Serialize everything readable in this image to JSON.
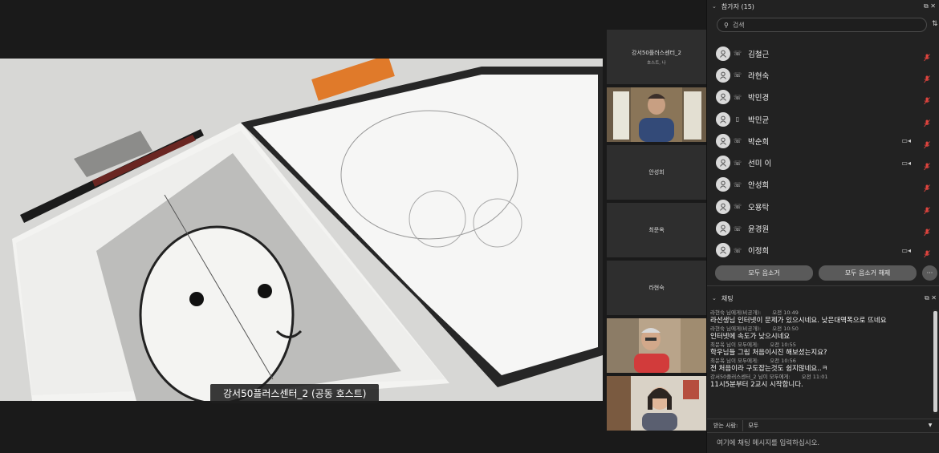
{
  "main": {
    "speaker_label": "강서50플러스센터_2 (공동 호스트)"
  },
  "thumbnails": [
    {
      "name": "강서50플러스센터_2",
      "sub": "호스트, 나",
      "video": false
    },
    {
      "name": "",
      "sub": "",
      "video": true
    },
    {
      "name": "안성희",
      "sub": "",
      "video": false
    },
    {
      "name": "최문옥",
      "sub": "",
      "video": false
    },
    {
      "name": "라현숙",
      "sub": "",
      "video": false
    },
    {
      "name": "",
      "sub": "",
      "video": true
    },
    {
      "name": "",
      "sub": "",
      "video": true
    }
  ],
  "participants": {
    "title": "참가자 (15)",
    "search_placeholder": "검색",
    "list": [
      {
        "name": "김철근",
        "device": "phone",
        "camera": false
      },
      {
        "name": "라현숙",
        "device": "phone",
        "camera": false
      },
      {
        "name": "박민경",
        "device": "phone",
        "camera": false
      },
      {
        "name": "박민균",
        "device": "mobile",
        "camera": false
      },
      {
        "name": "박순희",
        "device": "phone",
        "camera": true
      },
      {
        "name": "선미 이",
        "device": "phone",
        "camera": true
      },
      {
        "name": "안성희",
        "device": "phone",
        "camera": false
      },
      {
        "name": "오용탁",
        "device": "phone",
        "camera": false
      },
      {
        "name": "윤경원",
        "device": "phone",
        "camera": false
      },
      {
        "name": "이정희",
        "device": "phone",
        "camera": true
      }
    ],
    "mute_all": "모두 음소거",
    "unmute_all": "모두 음소거 해제",
    "more": "···"
  },
  "chat": {
    "title": "채팅",
    "messages": [
      {
        "from": "라현숙 님에게(비공개):",
        "time": "오전 10:49",
        "text": "라선생님 인터넷이 문제가 있으시네요. 낮은대역폭으로 뜨네요"
      },
      {
        "from": "라현숙 님에게(비공개):",
        "time": "오전 10:50",
        "text": "인터넷에   속도가 낮으시네요"
      },
      {
        "from": "최문옥 님이 모두에게:",
        "time": "오전 10:55",
        "text": "학우님들 그림 처음이시진 해보셨는지요?"
      },
      {
        "from": "최문옥 님이 모두에게:",
        "time": "오전 10:56",
        "text": "전 처음이라 구도잡는것도 쉽지않네요..ㅋ"
      },
      {
        "from": "강서50플러스센터_2 님이 모두에게:",
        "time": "오전 11:01",
        "text": "11시5분부터 2교시 시작합니다."
      }
    ],
    "to_label": "받는 사람:",
    "to_value": "모두",
    "compose_placeholder": "여기에 채팅 메시지를 입력하십시오."
  },
  "colors": {
    "panel_bg": "#222222",
    "button_bg": "#5a5a5a",
    "mic_muted": "#e0443e"
  }
}
